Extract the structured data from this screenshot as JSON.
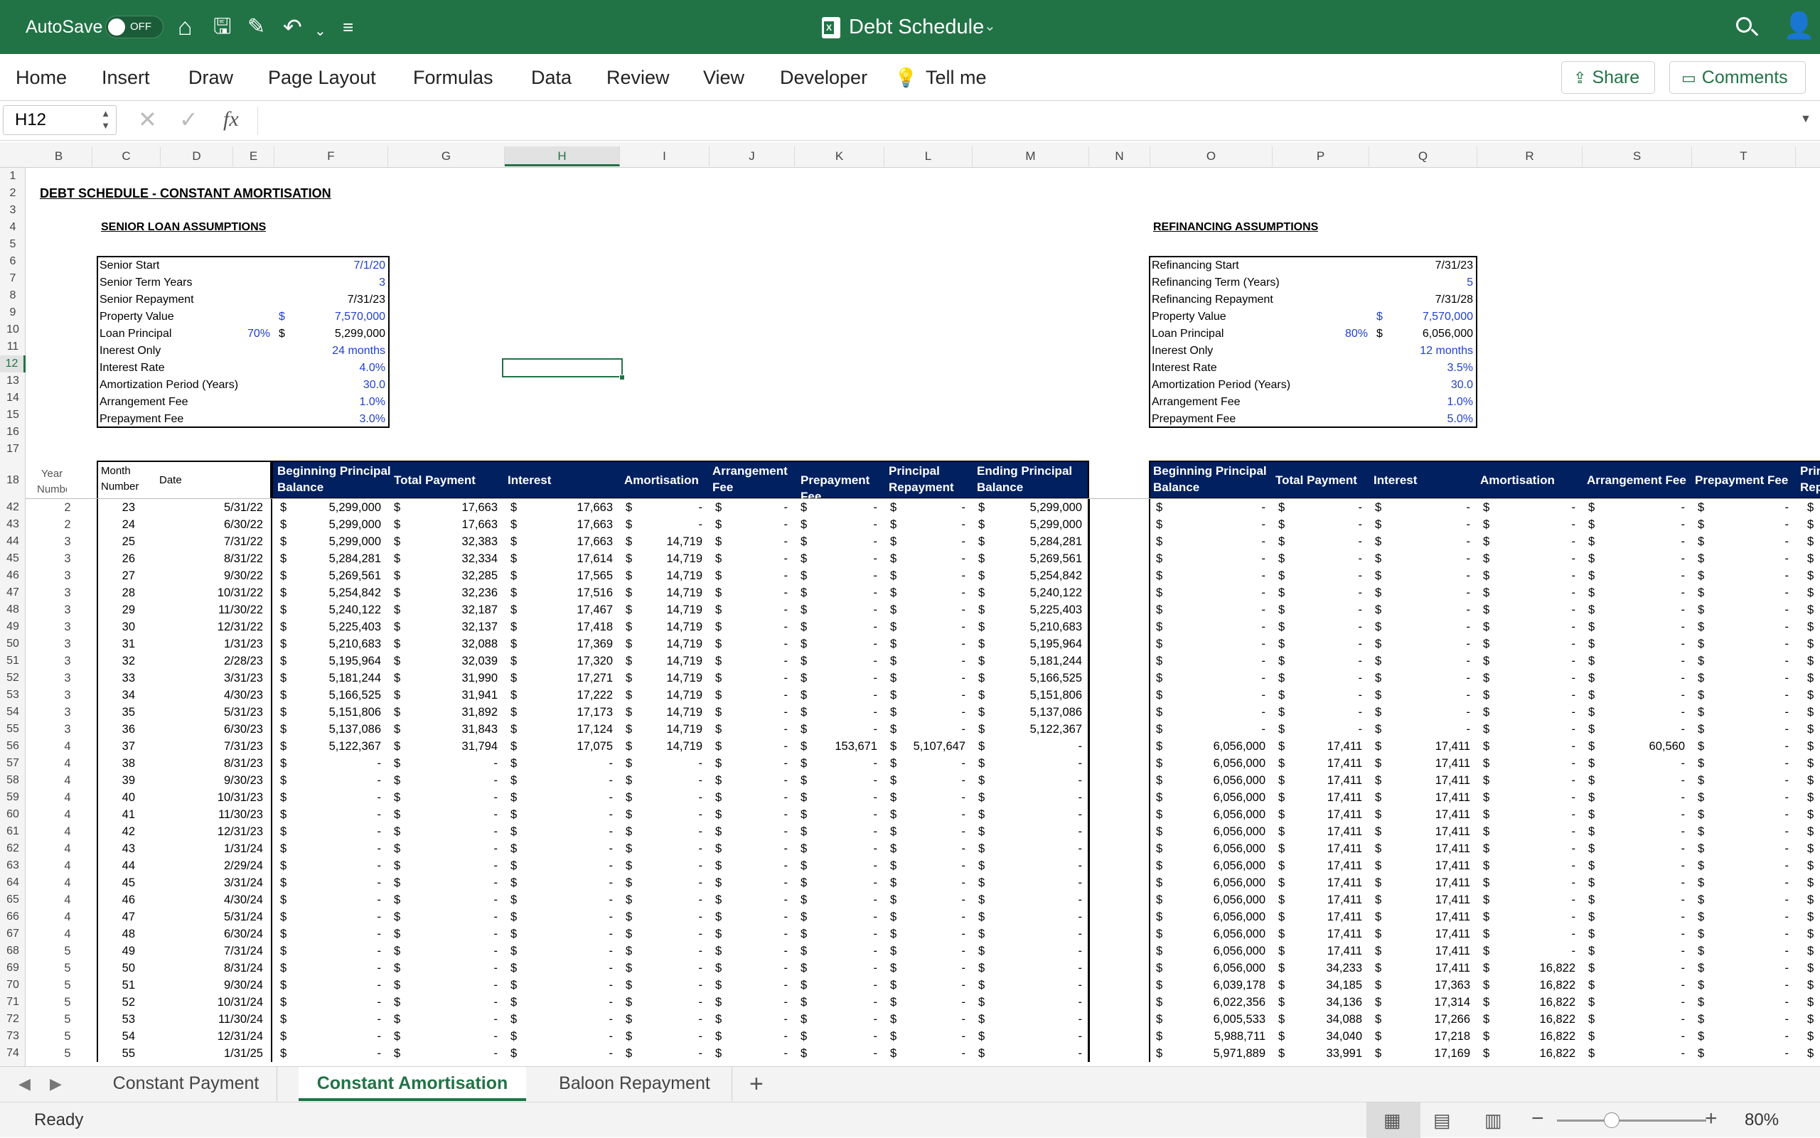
{
  "titlebar": {
    "autosave_label": "AutoSave",
    "toggle_label": "OFF",
    "doc_title": "Debt Schedule"
  },
  "menu": [
    "Home",
    "Insert",
    "Draw",
    "Page Layout",
    "Formulas",
    "Data",
    "Review",
    "View",
    "Developer",
    "Tell me"
  ],
  "actions": {
    "share": "Share",
    "comments": "Comments"
  },
  "formula_bar": {
    "name_box": "H12",
    "formula": ""
  },
  "sheet": {
    "title": "DEBT SCHEDULE - CONSTANT AMORTISATION",
    "senior_title": "SENIOR LOAN ASSUMPTIONS",
    "refi_title": "REFINANCING ASSUMPTIONS",
    "senior": [
      [
        "Senior Start",
        "",
        "",
        "7/1/20",
        true
      ],
      [
        "Senior Term Years",
        "",
        "",
        "3",
        true
      ],
      [
        "Senior Repayment",
        "",
        "",
        "7/31/23",
        false
      ],
      [
        "Property Value",
        "",
        "$",
        "7,570,000",
        true
      ],
      [
        "Loan Principal",
        "70%",
        "$",
        "5,299,000",
        false
      ],
      [
        "Inerest Only",
        "",
        "",
        "24 months",
        true
      ],
      [
        "Interest Rate",
        "",
        "",
        "4.0%",
        true
      ],
      [
        "Amortization Period (Years)",
        "",
        "",
        "30.0",
        true
      ],
      [
        "Arrangement Fee",
        "",
        "",
        "1.0%",
        true
      ],
      [
        "Prepayment Fee",
        "",
        "",
        "3.0%",
        true
      ]
    ],
    "refi": [
      [
        "Refinancing Start",
        "",
        "",
        "7/31/23",
        false
      ],
      [
        "Refinancing Term (Years)",
        "",
        "",
        "5",
        true
      ],
      [
        "Refinancing Repayment",
        "",
        "",
        "7/31/28",
        false
      ],
      [
        "Property Value",
        "",
        "$",
        "7,570,000",
        true
      ],
      [
        "Loan Principal",
        "80%",
        "$",
        "6,056,000",
        false
      ],
      [
        "Inerest Only",
        "",
        "",
        "12 months",
        true
      ],
      [
        "Interest Rate",
        "",
        "",
        "3.5%",
        true
      ],
      [
        "Amortization Period (Years)",
        "",
        "",
        "30.0",
        true
      ],
      [
        "Arrangement Fee",
        "",
        "",
        "1.0%",
        true
      ],
      [
        "Prepayment Fee",
        "",
        "",
        "5.0%",
        true
      ]
    ],
    "table_headers": {
      "year": "Year Number",
      "month": "Month Number",
      "date": "Date",
      "senior": [
        "Beginning Principal Balance",
        "Total Payment",
        "Interest",
        "Amortisation",
        "Arrangement Fee",
        "Prepayment Fee",
        "Principal Repayment",
        "Ending Principal Balance"
      ],
      "refi": [
        "Beginning Principal Balance",
        "Total Payment",
        "Interest",
        "Amortisation",
        "Arrangement Fee",
        "Prepayment Fee",
        "Prin Rep"
      ]
    },
    "columns": [
      "B",
      "C",
      "D",
      "E",
      "F",
      "G",
      "H",
      "I",
      "J",
      "K",
      "L",
      "M",
      "N",
      "O",
      "P",
      "Q",
      "R",
      "S",
      "T"
    ],
    "top_rows": [
      "1",
      "2",
      "3",
      "4",
      "5",
      "6",
      "7",
      "8",
      "9",
      "10",
      "11",
      "12",
      "13",
      "14",
      "15",
      "16",
      "17",
      "18"
    ],
    "rows": [
      [
        "42",
        "2",
        "23",
        "5/31/22",
        "5,299,000",
        "17,663",
        "17,663",
        "-",
        "-",
        "-",
        "-",
        "5,299,000",
        "-",
        "-",
        "-",
        "-",
        "-",
        "-"
      ],
      [
        "43",
        "2",
        "24",
        "6/30/22",
        "5,299,000",
        "17,663",
        "17,663",
        "-",
        "-",
        "-",
        "-",
        "5,299,000",
        "-",
        "-",
        "-",
        "-",
        "-",
        "-"
      ],
      [
        "44",
        "3",
        "25",
        "7/31/22",
        "5,299,000",
        "32,383",
        "17,663",
        "14,719",
        "-",
        "-",
        "-",
        "5,284,281",
        "-",
        "-",
        "-",
        "-",
        "-",
        "-"
      ],
      [
        "45",
        "3",
        "26",
        "8/31/22",
        "5,284,281",
        "32,334",
        "17,614",
        "14,719",
        "-",
        "-",
        "-",
        "5,269,561",
        "-",
        "-",
        "-",
        "-",
        "-",
        "-"
      ],
      [
        "46",
        "3",
        "27",
        "9/30/22",
        "5,269,561",
        "32,285",
        "17,565",
        "14,719",
        "-",
        "-",
        "-",
        "5,254,842",
        "-",
        "-",
        "-",
        "-",
        "-",
        "-"
      ],
      [
        "47",
        "3",
        "28",
        "10/31/22",
        "5,254,842",
        "32,236",
        "17,516",
        "14,719",
        "-",
        "-",
        "-",
        "5,240,122",
        "-",
        "-",
        "-",
        "-",
        "-",
        "-"
      ],
      [
        "48",
        "3",
        "29",
        "11/30/22",
        "5,240,122",
        "32,187",
        "17,467",
        "14,719",
        "-",
        "-",
        "-",
        "5,225,403",
        "-",
        "-",
        "-",
        "-",
        "-",
        "-"
      ],
      [
        "49",
        "3",
        "30",
        "12/31/22",
        "5,225,403",
        "32,137",
        "17,418",
        "14,719",
        "-",
        "-",
        "-",
        "5,210,683",
        "-",
        "-",
        "-",
        "-",
        "-",
        "-"
      ],
      [
        "50",
        "3",
        "31",
        "1/31/23",
        "5,210,683",
        "32,088",
        "17,369",
        "14,719",
        "-",
        "-",
        "-",
        "5,195,964",
        "-",
        "-",
        "-",
        "-",
        "-",
        "-"
      ],
      [
        "51",
        "3",
        "32",
        "2/28/23",
        "5,195,964",
        "32,039",
        "17,320",
        "14,719",
        "-",
        "-",
        "-",
        "5,181,244",
        "-",
        "-",
        "-",
        "-",
        "-",
        "-"
      ],
      [
        "52",
        "3",
        "33",
        "3/31/23",
        "5,181,244",
        "31,990",
        "17,271",
        "14,719",
        "-",
        "-",
        "-",
        "5,166,525",
        "-",
        "-",
        "-",
        "-",
        "-",
        "-"
      ],
      [
        "53",
        "3",
        "34",
        "4/30/23",
        "5,166,525",
        "31,941",
        "17,222",
        "14,719",
        "-",
        "-",
        "-",
        "5,151,806",
        "-",
        "-",
        "-",
        "-",
        "-",
        "-"
      ],
      [
        "54",
        "3",
        "35",
        "5/31/23",
        "5,151,806",
        "31,892",
        "17,173",
        "14,719",
        "-",
        "-",
        "-",
        "5,137,086",
        "-",
        "-",
        "-",
        "-",
        "-",
        "-"
      ],
      [
        "55",
        "3",
        "36",
        "6/30/23",
        "5,137,086",
        "31,843",
        "17,124",
        "14,719",
        "-",
        "-",
        "-",
        "5,122,367",
        "-",
        "-",
        "-",
        "-",
        "-",
        "-"
      ],
      [
        "56",
        "4",
        "37",
        "7/31/23",
        "5,122,367",
        "31,794",
        "17,075",
        "14,719",
        "-",
        "153,671",
        "5,107,647",
        "-",
        "6,056,000",
        "17,411",
        "17,411",
        "-",
        "60,560",
        "-"
      ],
      [
        "57",
        "4",
        "38",
        "8/31/23",
        "-",
        "-",
        "-",
        "-",
        "-",
        "-",
        "-",
        "-",
        "6,056,000",
        "17,411",
        "17,411",
        "-",
        "-",
        "-"
      ],
      [
        "58",
        "4",
        "39",
        "9/30/23",
        "-",
        "-",
        "-",
        "-",
        "-",
        "-",
        "-",
        "-",
        "6,056,000",
        "17,411",
        "17,411",
        "-",
        "-",
        "-"
      ],
      [
        "59",
        "4",
        "40",
        "10/31/23",
        "-",
        "-",
        "-",
        "-",
        "-",
        "-",
        "-",
        "-",
        "6,056,000",
        "17,411",
        "17,411",
        "-",
        "-",
        "-"
      ],
      [
        "60",
        "4",
        "41",
        "11/30/23",
        "-",
        "-",
        "-",
        "-",
        "-",
        "-",
        "-",
        "-",
        "6,056,000",
        "17,411",
        "17,411",
        "-",
        "-",
        "-"
      ],
      [
        "61",
        "4",
        "42",
        "12/31/23",
        "-",
        "-",
        "-",
        "-",
        "-",
        "-",
        "-",
        "-",
        "6,056,000",
        "17,411",
        "17,411",
        "-",
        "-",
        "-"
      ],
      [
        "62",
        "4",
        "43",
        "1/31/24",
        "-",
        "-",
        "-",
        "-",
        "-",
        "-",
        "-",
        "-",
        "6,056,000",
        "17,411",
        "17,411",
        "-",
        "-",
        "-"
      ],
      [
        "63",
        "4",
        "44",
        "2/29/24",
        "-",
        "-",
        "-",
        "-",
        "-",
        "-",
        "-",
        "-",
        "6,056,000",
        "17,411",
        "17,411",
        "-",
        "-",
        "-"
      ],
      [
        "64",
        "4",
        "45",
        "3/31/24",
        "-",
        "-",
        "-",
        "-",
        "-",
        "-",
        "-",
        "-",
        "6,056,000",
        "17,411",
        "17,411",
        "-",
        "-",
        "-"
      ],
      [
        "65",
        "4",
        "46",
        "4/30/24",
        "-",
        "-",
        "-",
        "-",
        "-",
        "-",
        "-",
        "-",
        "6,056,000",
        "17,411",
        "17,411",
        "-",
        "-",
        "-"
      ],
      [
        "66",
        "4",
        "47",
        "5/31/24",
        "-",
        "-",
        "-",
        "-",
        "-",
        "-",
        "-",
        "-",
        "6,056,000",
        "17,411",
        "17,411",
        "-",
        "-",
        "-"
      ],
      [
        "67",
        "4",
        "48",
        "6/30/24",
        "-",
        "-",
        "-",
        "-",
        "-",
        "-",
        "-",
        "-",
        "6,056,000",
        "17,411",
        "17,411",
        "-",
        "-",
        "-"
      ],
      [
        "68",
        "5",
        "49",
        "7/31/24",
        "-",
        "-",
        "-",
        "-",
        "-",
        "-",
        "-",
        "-",
        "6,056,000",
        "17,411",
        "17,411",
        "-",
        "-",
        "-"
      ],
      [
        "69",
        "5",
        "50",
        "8/31/24",
        "-",
        "-",
        "-",
        "-",
        "-",
        "-",
        "-",
        "-",
        "6,056,000",
        "34,233",
        "17,411",
        "16,822",
        "-",
        "-"
      ],
      [
        "70",
        "5",
        "51",
        "9/30/24",
        "-",
        "-",
        "-",
        "-",
        "-",
        "-",
        "-",
        "-",
        "6,039,178",
        "34,185",
        "17,363",
        "16,822",
        "-",
        "-"
      ],
      [
        "71",
        "5",
        "52",
        "10/31/24",
        "-",
        "-",
        "-",
        "-",
        "-",
        "-",
        "-",
        "-",
        "6,022,356",
        "34,136",
        "17,314",
        "16,822",
        "-",
        "-"
      ],
      [
        "72",
        "5",
        "53",
        "11/30/24",
        "-",
        "-",
        "-",
        "-",
        "-",
        "-",
        "-",
        "-",
        "6,005,533",
        "34,088",
        "17,266",
        "16,822",
        "-",
        "-"
      ],
      [
        "73",
        "5",
        "54",
        "12/31/24",
        "-",
        "-",
        "-",
        "-",
        "-",
        "-",
        "-",
        "-",
        "5,988,711",
        "34,040",
        "17,218",
        "16,822",
        "-",
        "-"
      ],
      [
        "74",
        "5",
        "55",
        "1/31/25",
        "-",
        "-",
        "-",
        "-",
        "-",
        "-",
        "-",
        "-",
        "5,971,889",
        "33,991",
        "17,169",
        "16,822",
        "-",
        "-"
      ]
    ]
  },
  "sheet_tabs": [
    "Constant Payment",
    "Constant Amortisation",
    "Baloon Repayment"
  ],
  "active_tab": 1,
  "status": {
    "ready": "Ready",
    "zoom": "80%"
  },
  "colors": {
    "excel_green": "#217346",
    "header_navy": "#002060",
    "input_blue": "#1f3fd1"
  }
}
